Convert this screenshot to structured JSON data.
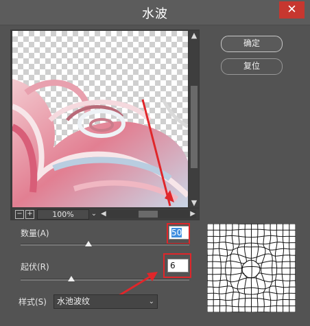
{
  "dialog": {
    "title": "水波",
    "close_glyph": "✕"
  },
  "buttons": {
    "ok_label": "确定",
    "reset_label": "复位"
  },
  "preview": {
    "zoom_level": "100%",
    "zoom_out_glyph": "−",
    "zoom_in_glyph": "+",
    "dropdown_glyph": "⌄",
    "scroll_up_glyph": "▲",
    "scroll_down_glyph": "▼",
    "scroll_left_glyph": "◀",
    "scroll_right_glyph": "▶"
  },
  "params": {
    "amount_label": "数量(A)",
    "amount_value": "50",
    "amount_fraction": 0.5,
    "ridges_label": "起伏(R)",
    "ridges_value": "6",
    "ridges_fraction": 0.3,
    "style_label": "样式(S)",
    "style_value": "水池波纹",
    "style_chevron": "⌄"
  },
  "colors": {
    "annotation_red": "#e0262a",
    "close_red": "#c7372f",
    "selection_blue": "#3f8ee0"
  }
}
